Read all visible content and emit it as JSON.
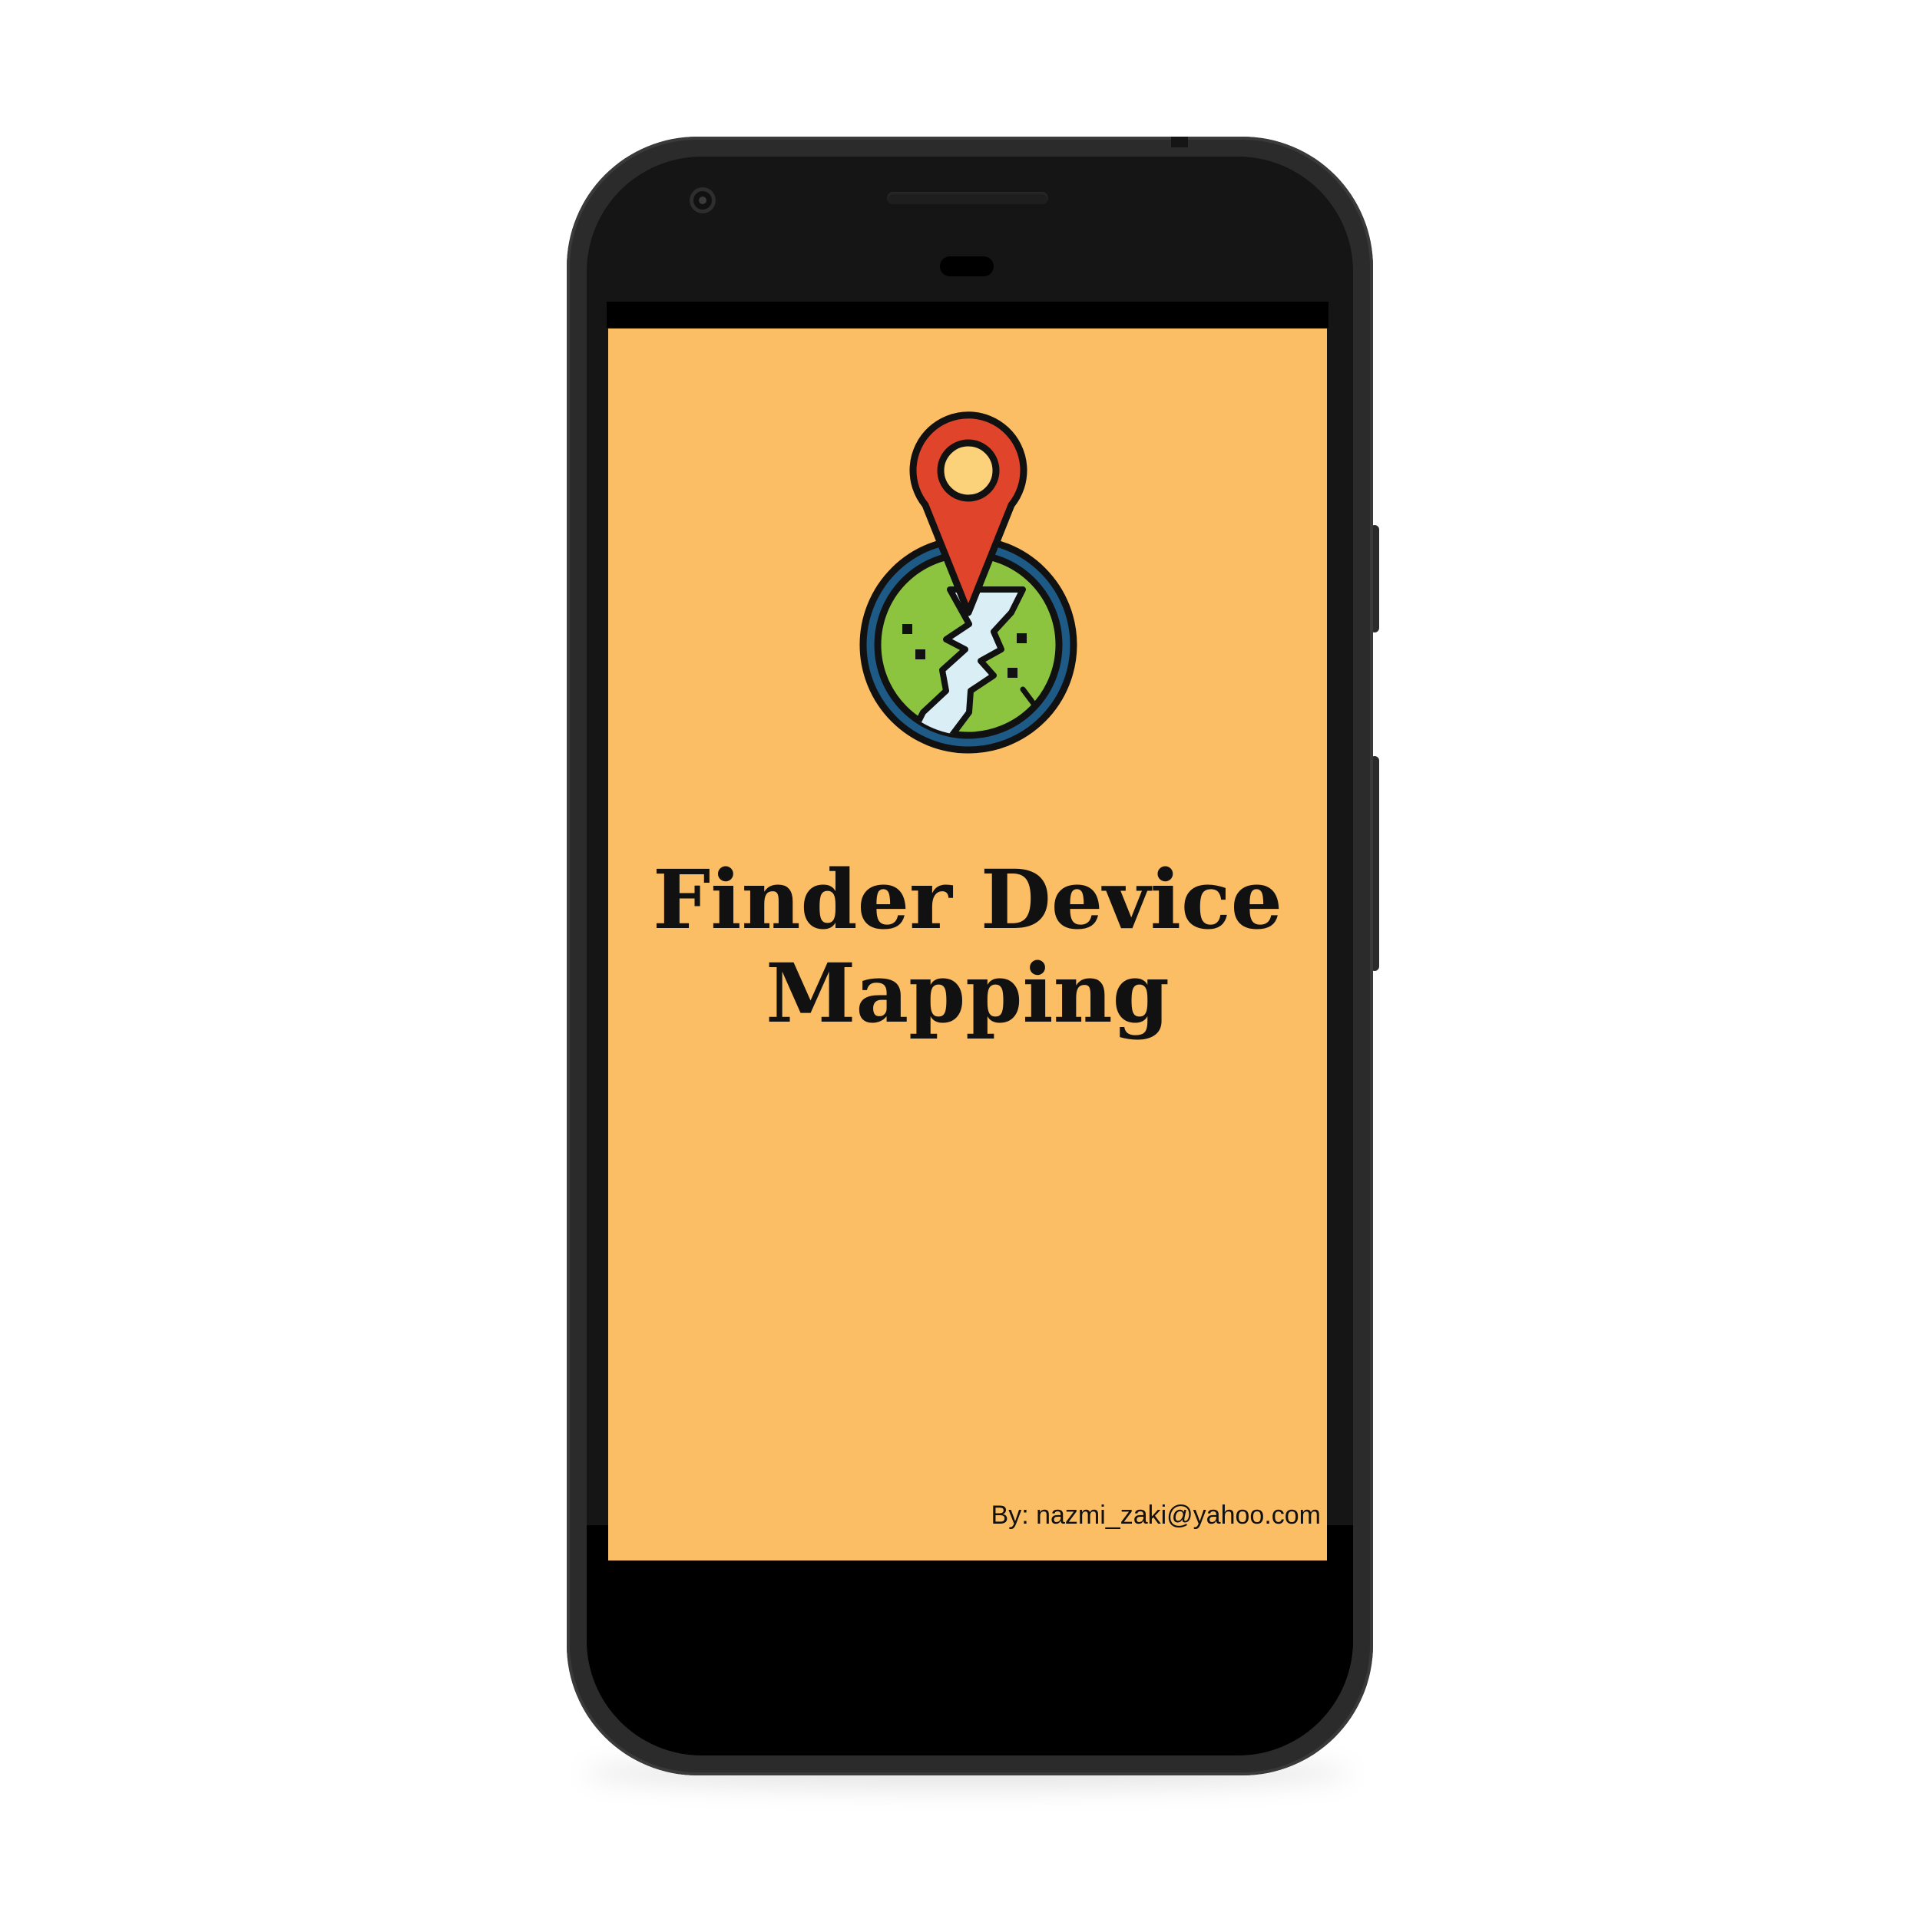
{
  "app": {
    "title_line1": "Finder Device",
    "title_line2": "Mapping",
    "author": "By: nazmi_zaki@yahoo.com"
  },
  "logo": {
    "icon": "map-pin-globe-icon"
  },
  "colors": {
    "screen_background": "#fcbe64",
    "pin": "#e0452b",
    "pin_center": "#fbd27a",
    "globe_ring": "#1e5a86",
    "land": "#8cc43f",
    "water": "#d9eef5"
  }
}
